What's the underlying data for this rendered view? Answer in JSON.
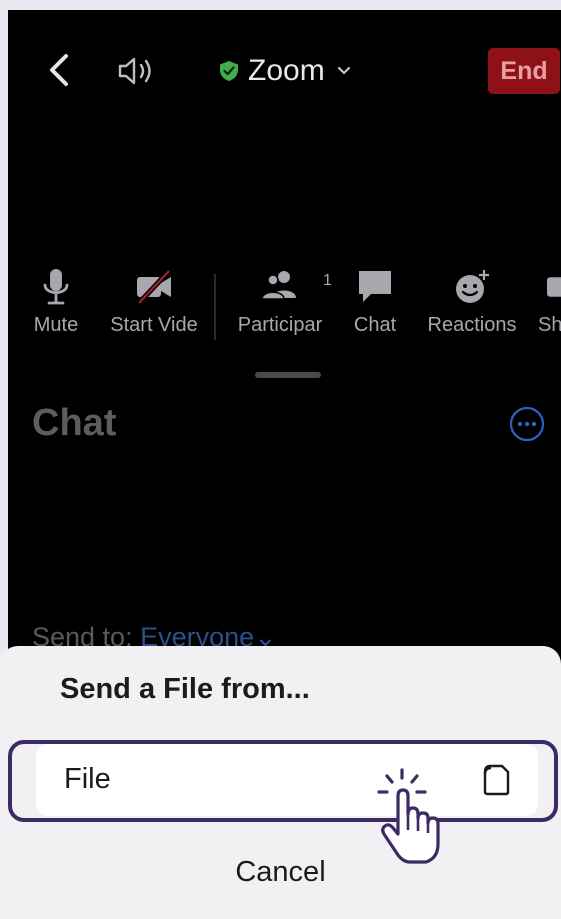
{
  "topbar": {
    "title": "Zoom",
    "end_label": "End"
  },
  "toolbar": {
    "items": [
      {
        "label": "Mute",
        "icon": "microphone-icon"
      },
      {
        "label": "Start Vide",
        "icon": "video-off-icon"
      },
      {
        "label": "Participar",
        "icon": "participants-icon",
        "badge": "1"
      },
      {
        "label": "Chat",
        "icon": "chat-icon"
      },
      {
        "label": "Reactions",
        "icon": "reactions-icon"
      },
      {
        "label": "Sh",
        "icon": "share-icon"
      }
    ]
  },
  "chat": {
    "title": "Chat",
    "send_to_prefix": "Send to: ",
    "send_to_target": "Everyone"
  },
  "sheet": {
    "title": "Send a File from...",
    "options": [
      {
        "label": "File",
        "icon": "file-icon"
      }
    ],
    "cancel_label": "Cancel"
  },
  "colors": {
    "end_button": "#8e1117",
    "secure_shield": "#3fae49",
    "highlight_border": "#3e2a63",
    "link_blue": "#2b4f8a"
  }
}
